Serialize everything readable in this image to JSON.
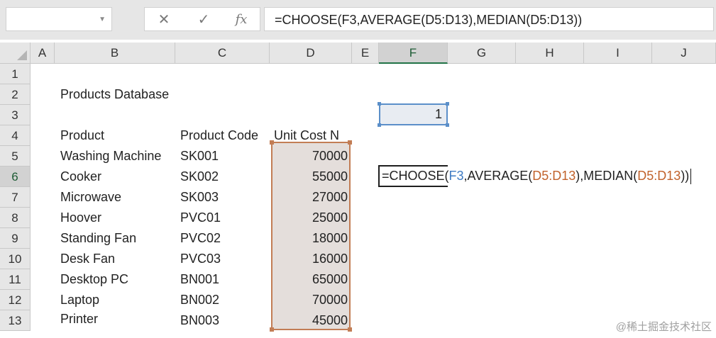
{
  "formula_bar": {
    "name_box": "",
    "formula": "=CHOOSE(F3,AVERAGE(D5:D13),MEDIAN(D5:D13))",
    "fx_label": "fx"
  },
  "columns": [
    "A",
    "B",
    "C",
    "D",
    "E",
    "F",
    "G",
    "H",
    "I",
    "J"
  ],
  "rows": [
    "1",
    "2",
    "3",
    "4",
    "5",
    "6",
    "7",
    "8",
    "9",
    "10",
    "11",
    "12",
    "13"
  ],
  "sheet": {
    "title": "Products Database",
    "headers": {
      "product": "Product",
      "code": "Product Code",
      "cost": "Unit Cost N"
    },
    "items": [
      {
        "product": "Washing Machine",
        "code": "SK001",
        "cost": "70000"
      },
      {
        "product": "Cooker",
        "code": "SK002",
        "cost": "55000"
      },
      {
        "product": "Microwave",
        "code": "SK003",
        "cost": "27000"
      },
      {
        "product": "Hoover",
        "code": "PVC01",
        "cost": "25000"
      },
      {
        "product": "Standing Fan",
        "code": "PVC02",
        "cost": "18000"
      },
      {
        "product": "Desk Fan",
        "code": "PVC03",
        "cost": "16000"
      },
      {
        "product": "Desktop PC",
        "code": "BN001",
        "cost": "65000"
      },
      {
        "product": "Laptop",
        "code": "BN002",
        "cost": "70000"
      },
      {
        "product": "Printer",
        "code": "BN003",
        "cost": "45000"
      }
    ],
    "f3_value": "1"
  },
  "edit": {
    "p1": "=CHOOSE(",
    "ref1": "F3",
    "p2": ",AVERAGE(",
    "ref2": "D5:D13",
    "p3": "),MEDIAN(",
    "ref3": "D5:D13",
    "p4": "))"
  },
  "watermark": "@稀土掘金技术社区"
}
